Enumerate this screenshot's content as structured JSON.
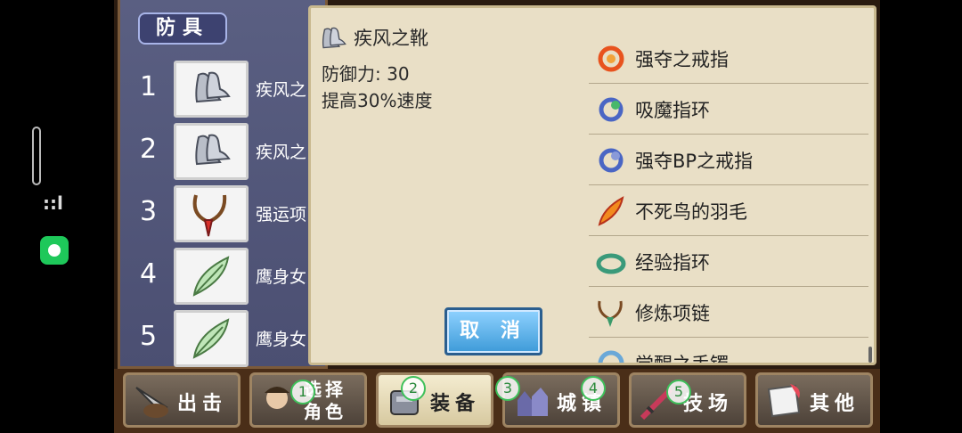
{
  "system": {
    "signal_text": "::l"
  },
  "category": {
    "label": "防具"
  },
  "equipment_slots": [
    {
      "num": "1",
      "name": "疾风之",
      "icon": "boots-icon"
    },
    {
      "num": "2",
      "name": "疾风之",
      "icon": "boots-icon"
    },
    {
      "num": "3",
      "name": "强运项",
      "icon": "necklace-icon"
    },
    {
      "num": "4",
      "name": "鹰身女",
      "icon": "feather-icon"
    },
    {
      "num": "5",
      "name": "鹰身女",
      "icon": "feather-icon"
    }
  ],
  "detail": {
    "name": "疾风之靴",
    "defense": "防御力: 30",
    "effect": "提高30%速度",
    "icon": "boots-icon"
  },
  "cancel_label": "取 消",
  "items": [
    {
      "label": "强夺之戒指",
      "icon": "red-ring-icon"
    },
    {
      "label": "吸魔指环",
      "icon": "blue-ring-icon"
    },
    {
      "label": "强夺BP之戒指",
      "icon": "blue-ring-icon"
    },
    {
      "label": "不死鸟的羽毛",
      "icon": "phoenix-feather-icon"
    },
    {
      "label": "经验指环",
      "icon": "green-ring-icon"
    },
    {
      "label": "修炼项链",
      "icon": "necklace-icon"
    },
    {
      "label": "觉醒之手镯",
      "icon": "bracelet-icon"
    }
  ],
  "tabs": [
    {
      "label": "出击",
      "icon": "sortie-icon"
    },
    {
      "label": "选择\n角色",
      "icon": "character-icon"
    },
    {
      "label": "装备",
      "icon": "equipment-icon"
    },
    {
      "label": "城镇",
      "icon": "town-icon"
    },
    {
      "label": "技场",
      "icon": "arena-icon"
    },
    {
      "label": "其他",
      "icon": "other-icon"
    }
  ],
  "markers": [
    "1",
    "2",
    "3",
    "4",
    "5"
  ]
}
